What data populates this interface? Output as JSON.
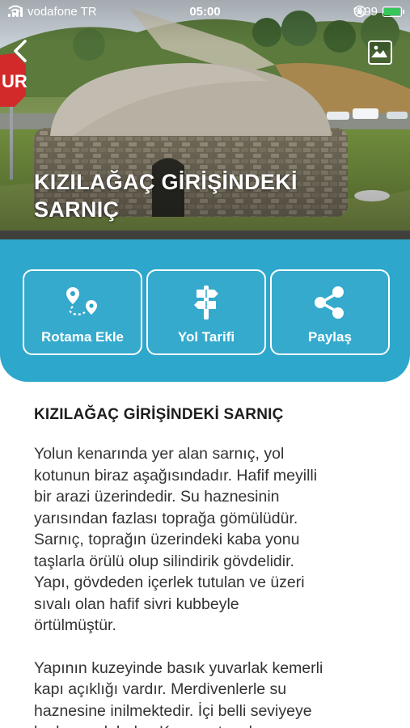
{
  "status_bar": {
    "carrier": "vodafone TR",
    "time": "05:00",
    "battery": "%99"
  },
  "hero": {
    "title": "KIZILAĞAÇ GİRİŞİNDEKİ\nSARNIÇ",
    "back_icon": "chevron-left-icon",
    "gallery_icon": "image-gallery-icon"
  },
  "actions": [
    {
      "label": "Rotama Ekle",
      "icon": "route-pin-icon"
    },
    {
      "label": "Yol Tarifi",
      "icon": "signpost-icon"
    },
    {
      "label": "Paylaş",
      "icon": "share-icon"
    }
  ],
  "colors": {
    "accent": "#2da7cb",
    "battery": "#35c759"
  },
  "content": {
    "title": "KIZILAĞAÇ GİRİŞİNDEKİ SARNIÇ",
    "paragraph_1": "Yolun kenarında yer alan sarnıç, yol\nkotunun biraz aşağısındadır. Hafif meyilli\nbir arazi üzerindedir. Su haznesinin\nyarısından fazlası toprağa gömülüdür.\nSarnıç, toprağın üzerindeki kaba yonu\ntaşlarla örülü olup silindirik gövdelidir.\nYapı, gövdeden içerlek tutulan ve üzeri\nsıvalı olan hafif sivri kubbeyle\nörtülmüştür.",
    "paragraph_2": "Yapının kuzeyinde basık yuvarlak kemerli\nkapı açıklığı vardır. Merdivenlerle su\nhaznesine inilmektedir. İçi belli seviyeye\nkadar su doludur. Kapının tam karşısına"
  }
}
